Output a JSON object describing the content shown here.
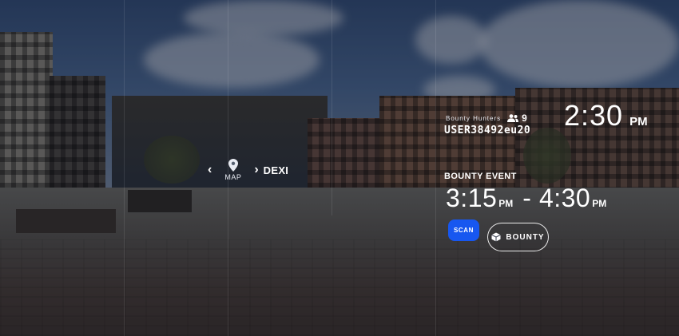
{
  "map_nav": {
    "prev_icon": "chevron-left-icon",
    "map_icon": "map-pin-icon",
    "map_label": "MAP",
    "next_icon": "chevron-right-icon",
    "destination": "DEXI"
  },
  "status": {
    "group_label": "Bounty Hunters",
    "group_icon": "people-icon",
    "group_count": "9",
    "username": "USER38492eu20"
  },
  "clock": {
    "time": "2:30",
    "period": "PM"
  },
  "event": {
    "label": "BOUNTY EVENT",
    "start_time": "3:15",
    "start_period": "PM",
    "separator": "-",
    "end_time": "4:30",
    "end_period": "PM"
  },
  "actions": {
    "scan_label": "SCAN",
    "bounty_icon": "cube-icon",
    "bounty_label": "BOUNTY"
  },
  "colors": {
    "scan_accent": "#1757f0",
    "hud_text": "#ffffff"
  }
}
